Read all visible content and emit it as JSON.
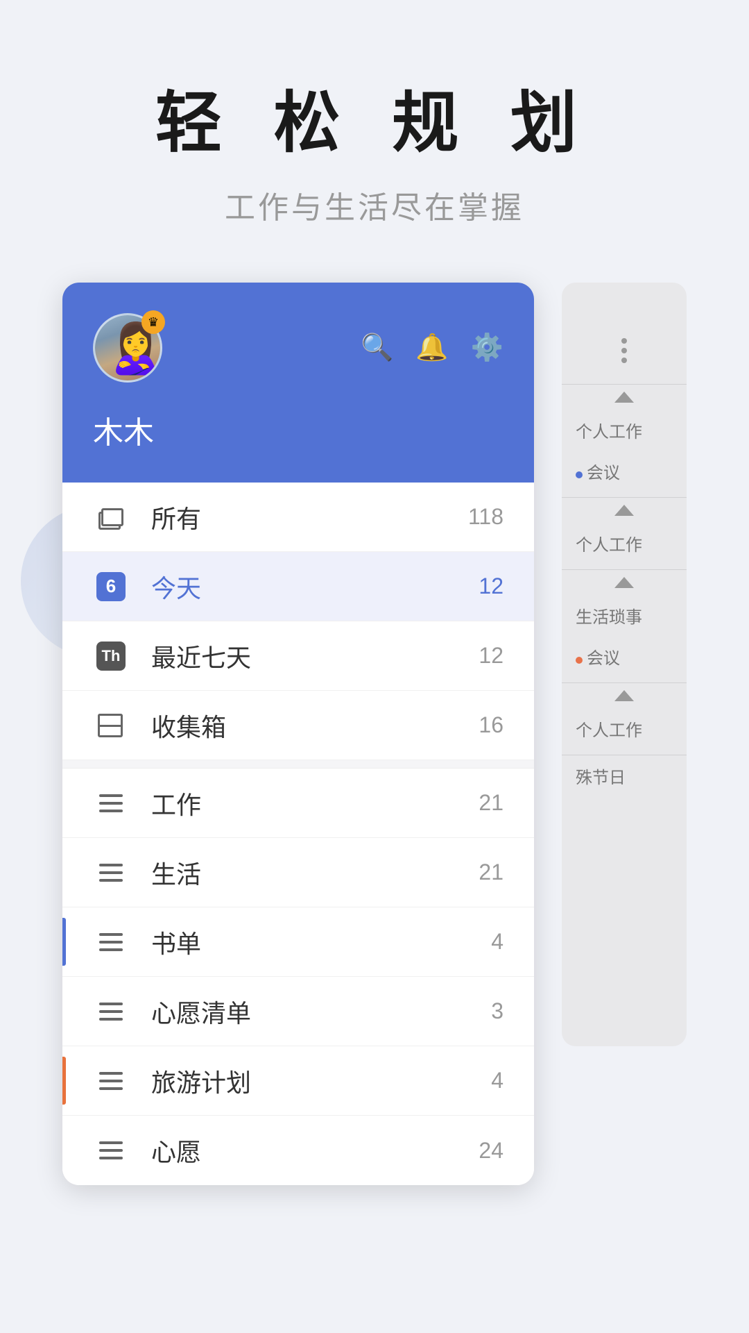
{
  "header": {
    "title": "轻 松 规 划",
    "subtitle": "工作与生活尽在掌握"
  },
  "user": {
    "name": "木木",
    "crown": "👑"
  },
  "icons": {
    "search": "🔍",
    "bell": "🔔",
    "gear": "⚙️",
    "more": "⋮",
    "crown": "♛"
  },
  "menu": {
    "items": [
      {
        "id": "all",
        "label": "所有",
        "count": "118",
        "active": false
      },
      {
        "id": "today",
        "label": "今天",
        "count": "12",
        "active": true
      },
      {
        "id": "week",
        "label": "最近七天",
        "count": "12",
        "active": false
      },
      {
        "id": "inbox",
        "label": "收集箱",
        "count": "16",
        "active": false
      },
      {
        "id": "work",
        "label": "工作",
        "count": "21",
        "active": false
      },
      {
        "id": "life",
        "label": "生活",
        "count": "21",
        "active": false
      },
      {
        "id": "books",
        "label": "书单",
        "count": "4",
        "active": false
      },
      {
        "id": "wishes",
        "label": "心愿清单",
        "count": "3",
        "active": false
      },
      {
        "id": "travel",
        "label": "旅游计划",
        "count": "4",
        "active": false
      },
      {
        "id": "heart",
        "label": "心愿",
        "count": "24",
        "active": false
      }
    ]
  },
  "right_panel": {
    "sections": [
      {
        "label": "个人工作",
        "items": [
          "●会议"
        ]
      },
      {
        "label": "个人工作",
        "items": []
      },
      {
        "label": "生活琐事",
        "items": [
          "●会议"
        ]
      },
      {
        "label": "个人工作",
        "items": []
      },
      {
        "label": "殊节日",
        "items": []
      }
    ]
  }
}
